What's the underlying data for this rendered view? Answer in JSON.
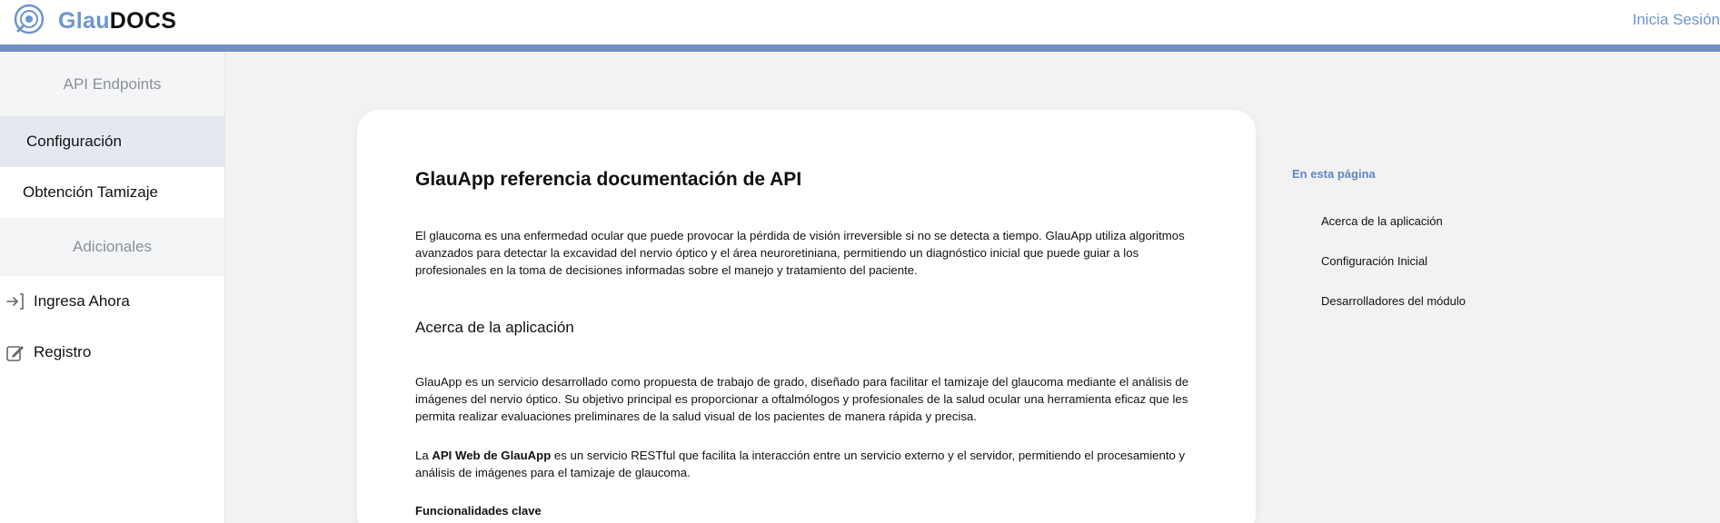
{
  "header": {
    "brand_part1": "Glau",
    "brand_part2": "DOCS",
    "login_link": "Inicia Sesión",
    "logo_icon": "eye-lens-icon"
  },
  "sidebar": {
    "section1": "API Endpoints",
    "items": [
      {
        "label": "Configuración",
        "active": true
      },
      {
        "label": "Obtención Tamizaje",
        "active": false
      }
    ],
    "section2": "Adicionales",
    "links": [
      {
        "label": "Ingresa Ahora",
        "icon": "sign-in-icon"
      },
      {
        "label": "Registro",
        "icon": "edit-form-icon"
      }
    ]
  },
  "document": {
    "title": "GlauApp referencia documentación de API",
    "intro": "El glaucoma es una enfermedad ocular que puede provocar la pérdida de visión irreversible si no se detecta a tiempo. GlauApp utiliza algoritmos avanzados para detectar la excavidad del nervio óptico y el área neuroretiniana, permitiendo un diagnóstico inicial que puede guiar a los profesionales en la toma de decisiones informadas sobre el manejo y tratamiento del paciente.",
    "section_about": "Acerca de la aplicación",
    "about_text": "GlauApp es un servicio desarrollado como propuesta de trabajo de grado, diseñado para facilitar el tamizaje del glaucoma mediante el análisis de imágenes del nervio óptico. Su objetivo principal es proporcionar a oftalmólogos y profesionales de la salud ocular una herramienta eficaz que les permita realizar evaluaciones preliminares de la salud visual de los pacientes de manera rápida y precisa.",
    "api_prefix": "La ",
    "api_bold": "API Web de GlauApp",
    "api_suffix": " es un servicio RESTful que facilita la interacción entre un servicio externo y el servidor, permitiendo el procesamiento y análisis de imágenes para el tamizaje de glaucoma.",
    "section_features": "Funcionalidades clave"
  },
  "toc": {
    "title": "En esta página",
    "items": [
      "Acerca de la aplicación",
      "Configuración Inicial",
      "Desarrolladores del módulo"
    ]
  },
  "colors": {
    "accent": "#6b96cf",
    "rule": "#6f90c0",
    "main_bg": "#f2f2f3",
    "active_item": "#e4e9f1"
  }
}
